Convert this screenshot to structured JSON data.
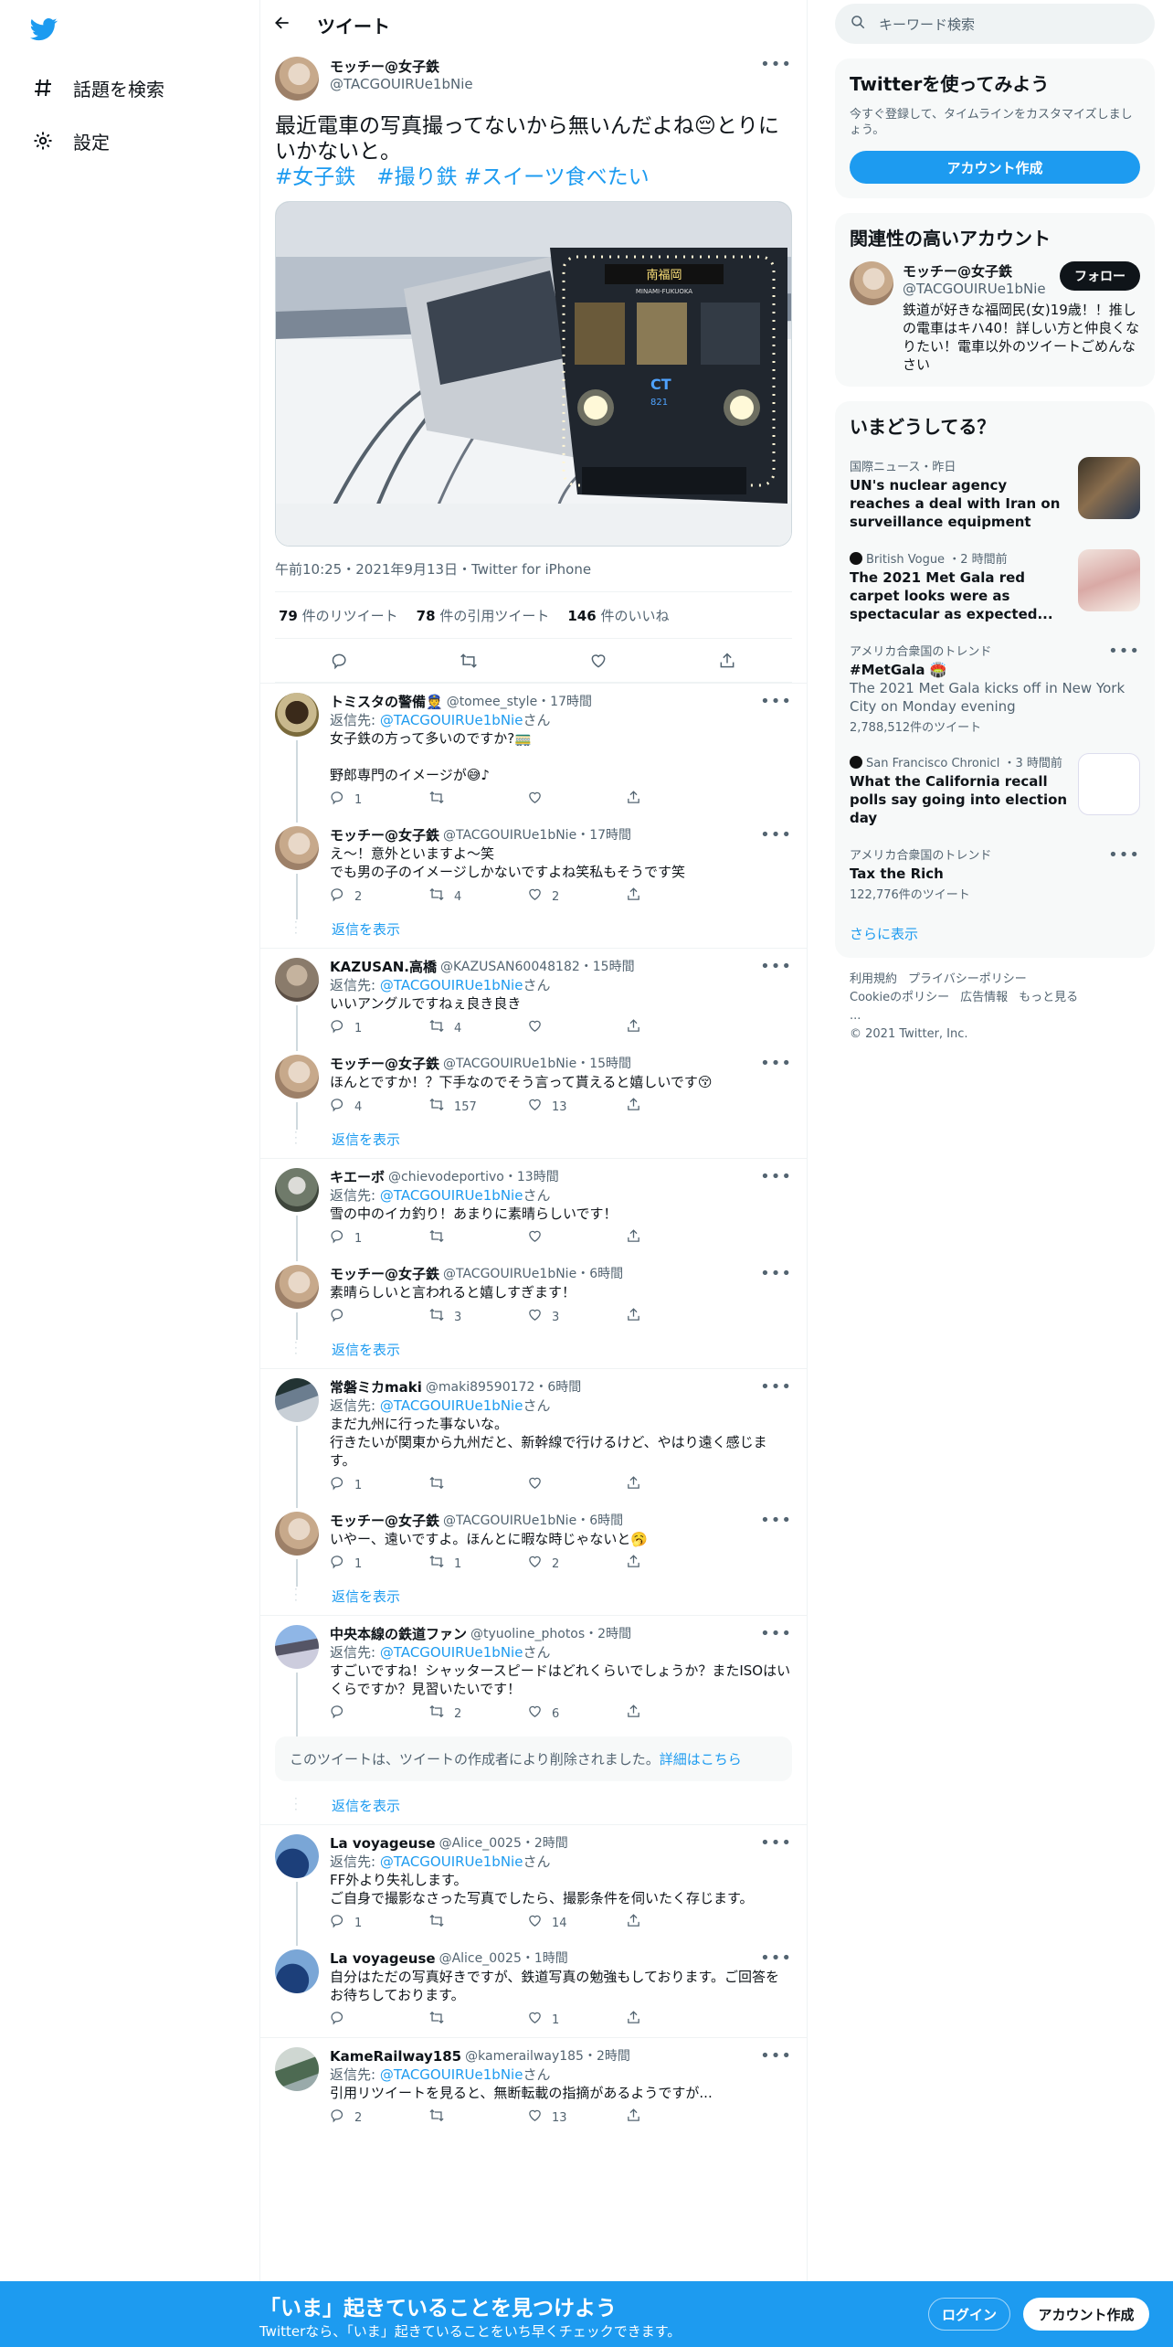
{
  "nav": {
    "explore": "話題を検索",
    "settings": "設定"
  },
  "header": {
    "title": "ツイート"
  },
  "main": {
    "display_name": "モッチー@女子鉄",
    "handle": "@TACGOUIRUe1bNie",
    "text": "最近電車の写真撮ってないから無いんだよね😔とりにいかないと。",
    "hashtags": "#女子鉄　#撮り鉄 #スイーツ食べたい",
    "photo": {
      "dest_sign": "南福岡",
      "dest_sign_en": "MINAMI-FUKUOKA",
      "logo": "CT",
      "car_number": "821"
    },
    "meta": "午前10:25・2021年9月13日・Twitter for iPhone",
    "retweets_n": "79",
    "retweets_l": "件のリツイート",
    "quotes_n": "78",
    "quotes_l": "件の引用ツイート",
    "likes_n": "146",
    "likes_l": "件のいいね"
  },
  "replies": [
    {
      "name": "トミスタの警備👮",
      "handle": "@tomee_style・17時間",
      "reply_prefix": "返信先: ",
      "reply_to": "@TACGOUIRUe1bNie",
      "reply_suffix": "さん",
      "text": "女子鉄の方って多いのですか?🚃\n\n野郎専門のイメージが😅♪",
      "c": "1",
      "r": "",
      "l": ""
    },
    {
      "name": "モッチー@女子鉄",
      "handle": "@TACGOUIRUe1bNie・17時間",
      "text": "え〜！意外といますよ〜笑\nでも男の子のイメージしかないですよね笑私もそうです笑",
      "c": "2",
      "r": "4",
      "l": "2"
    },
    {
      "name": "KAZUSAN.高橋",
      "handle": "@KAZUSAN60048182・15時間",
      "reply_prefix": "返信先: ",
      "reply_to": "@TACGOUIRUe1bNie",
      "reply_suffix": "さん",
      "text": "いいアングルですねぇ良き良き",
      "c": "1",
      "r": "4",
      "l": ""
    },
    {
      "name": "モッチー@女子鉄",
      "handle": "@TACGOUIRUe1bNie・15時間",
      "text": "ほんとですか！？下手なのでそう言って貰えると嬉しいです😚",
      "c": "4",
      "r": "157",
      "l": "13"
    },
    {
      "name": "キエーボ",
      "handle": "@chievodeportivo・13時間",
      "reply_prefix": "返信先: ",
      "reply_to": "@TACGOUIRUe1bNie",
      "reply_suffix": "さん",
      "text": "雪の中のイカ釣り！あまりに素晴らしいです！",
      "c": "1",
      "r": "",
      "l": ""
    },
    {
      "name": "モッチー@女子鉄",
      "handle": "@TACGOUIRUe1bNie・6時間",
      "text": "素晴らしいと言われると嬉しすぎます！",
      "c": "",
      "r": "3",
      "l": "3"
    },
    {
      "name": "常磐ミカmaki",
      "handle": "@maki89590172・6時間",
      "reply_prefix": "返信先: ",
      "reply_to": "@TACGOUIRUe1bNie",
      "reply_suffix": "さん",
      "text": "まだ九州に行った事ないな。\n行きたいが関東から九州だと、新幹線で行けるけど、やはり遠く感じます。",
      "c": "1",
      "r": "",
      "l": ""
    },
    {
      "name": "モッチー@女子鉄",
      "handle": "@TACGOUIRUe1bNie・6時間",
      "text": "いやー、遠いですよ。ほんとに暇な時じゃないと🥱",
      "c": "1",
      "r": "1",
      "l": "2"
    },
    {
      "name": "中央本線の鉄道ファン",
      "handle": "@tyuoline_photos・2時間",
      "reply_prefix": "返信先: ",
      "reply_to": "@TACGOUIRUe1bNie",
      "reply_suffix": "さん",
      "text": "すごいですね！シャッタースピードはどれくらいでしょうか？またISOはいくらですか？見習いたいです！",
      "c": "",
      "r": "2",
      "l": "6"
    },
    {
      "name": "La voyageuse",
      "handle": "@Alice_0025・2時間",
      "reply_prefix": "返信先: ",
      "reply_to": "@TACGOUIRUe1bNie",
      "reply_suffix": "さん",
      "text": "FF外より失礼します。\nご自身で撮影なさった写真でしたら、撮影条件を伺いたく存じます。",
      "c": "1",
      "r": "",
      "l": "14"
    },
    {
      "name": "La voyageuse",
      "handle": "@Alice_0025・1時間",
      "text": "自分はただの写真好きですが、鉄道写真の勉強もしております。ご回答をお待ちしております。",
      "c": "",
      "r": "",
      "l": "1"
    },
    {
      "name": "KameRailway185",
      "handle": "@kamerailway185・2時間",
      "reply_prefix": "返信先: ",
      "reply_to": "@TACGOUIRUe1bNie",
      "reply_suffix": "さん",
      "text": "引用リツイートを見ると、無断転載の指摘があるようですが...",
      "c": "2",
      "r": "",
      "l": "13"
    }
  ],
  "show_replies": "返信を表示",
  "deleted": {
    "text": "このツイートは、ツイートの作成者により削除されました。",
    "link": "詳細はこちら"
  },
  "right": {
    "search_placeholder": "キーワード検索",
    "signup_card": {
      "title": "Twitterを使ってみよう",
      "sub": "今すぐ登録して、タイムラインをカスタマイズしましょう。",
      "button": "アカウント作成"
    },
    "relevant": {
      "title": "関連性の高いアカウント",
      "name": "モッチー@女子鉄",
      "handle": "@TACGOUIRUe1bNie",
      "follow": "フォロー",
      "bio": "鉄道が好きな福岡民(女)19歳！！推しの電車はキハ40！詳しい方と仲良くなりたい！電車以外のツイートごめんなさい"
    },
    "trends_title": "いまどうしてる？",
    "trends": [
      {
        "meta": "国際ニュース・昨日",
        "head": "UN's nuclear agency reaches a deal with Iran on surveillance equipment"
      },
      {
        "meta": "British Vogue ・2 時間前",
        "head": "The 2021 Met Gala red carpet looks were as spectacular as expected..."
      },
      {
        "meta": "アメリカ合衆国のトレンド",
        "head": "#MetGala 🏟️",
        "sub": "The 2021 Met Gala kicks off in New York City on Monday evening",
        "count": "2,788,512件のツイート"
      },
      {
        "meta": "San Francisco Chronicl ・3 時間前",
        "head": "What the California recall polls say going into election day"
      },
      {
        "meta": "アメリカ合衆国のトレンド",
        "head": "Tax the Rich",
        "count": "122,776件のツイート"
      }
    ],
    "show_more": "さらに表示",
    "footer": {
      "terms": "利用規約",
      "privacy": "プライバシーポリシー",
      "cookie": "Cookieのポリシー",
      "ads": "広告情報",
      "more": "もっと見る ...",
      "copy": "© 2021 Twitter, Inc."
    }
  },
  "bottom": {
    "title": "「いま」起きていることを見つけよう",
    "sub": "Twitterなら、「いま」起きていることをいち早くチェックできます。",
    "login": "ログイン",
    "signup": "アカウント作成"
  },
  "colors": {
    "accent": "#1d9bf0",
    "text": "#0f1419",
    "muted": "#536471",
    "border": "#eff3f4"
  }
}
